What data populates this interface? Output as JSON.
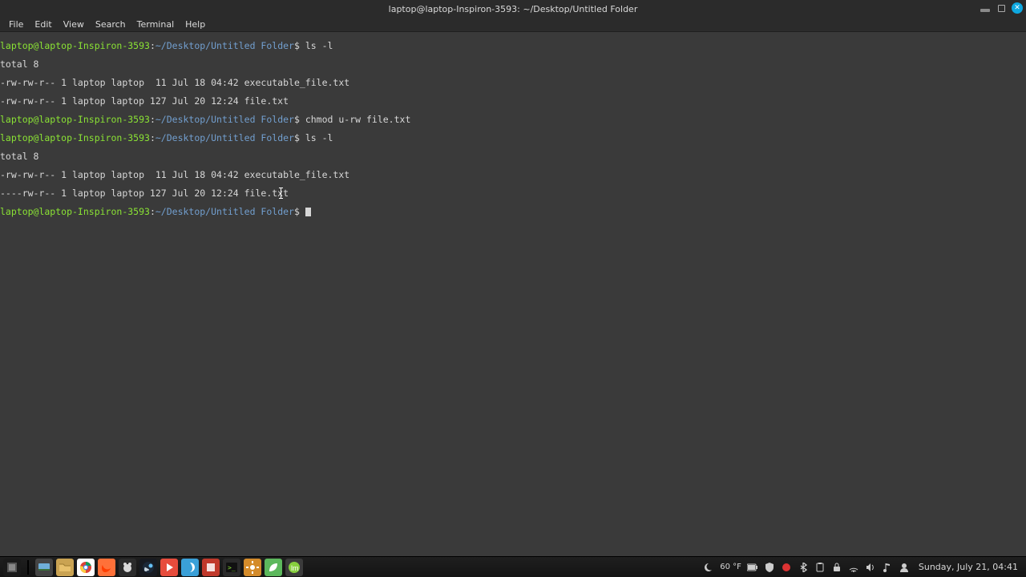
{
  "window": {
    "title": "laptop@laptop-Inspiron-3593: ~/Desktop/Untitled Folder"
  },
  "menubar": {
    "items": [
      "File",
      "Edit",
      "View",
      "Search",
      "Terminal",
      "Help"
    ]
  },
  "prompt": {
    "userhost": "laptop@laptop-Inspiron-3593",
    "sep": ":",
    "path": "~/Desktop/Untitled Folder",
    "sigil": "$"
  },
  "session": {
    "cmd1": " ls -l",
    "out1_total": "total 8",
    "out1_line1": "-rw-rw-r-- 1 laptop laptop  11 Jul 18 04:42 executable_file.txt",
    "out1_line2": "-rw-rw-r-- 1 laptop laptop 127 Jul 20 12:24 file.txt",
    "cmd2": " chmod u-rw file.txt",
    "cmd3": " ls -l",
    "out2_total": "total 8",
    "out2_line1": "-rw-rw-r-- 1 laptop laptop  11 Jul 18 04:42 executable_file.txt",
    "out2_line2": "----rw-r-- 1 laptop laptop 127 Jul 20 12:24 file.txt",
    "cmd4": " "
  },
  "taskbar": {
    "weather": "60 °F",
    "datetime": "Sunday, July 21, 04:41"
  },
  "launchers": {
    "start": "⊞",
    "showdesktop": "▭",
    "files": "files",
    "chrome": "chrome",
    "firefox": "firefox",
    "xfce": "xfce",
    "steam": "steam",
    "video": "video",
    "swirl": "swirl",
    "red": "red",
    "term": "term",
    "cog": "cog",
    "leaf": "leaf",
    "mint": "mint"
  },
  "tray_icons": [
    "weather",
    "battery",
    "shield",
    "record",
    "bt",
    "clipboard",
    "lock",
    "net",
    "vol",
    "music",
    "user"
  ]
}
